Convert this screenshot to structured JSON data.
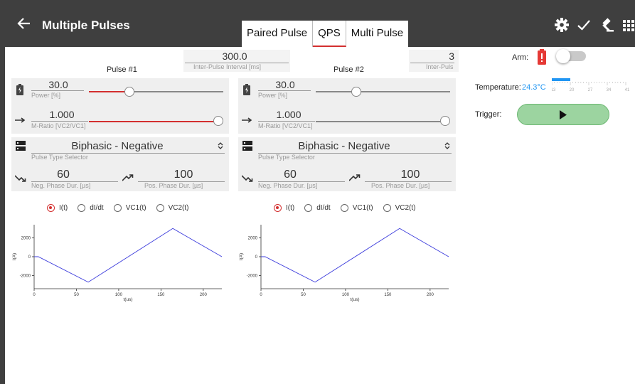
{
  "header": {
    "title": "Multiple Pulses",
    "back_icon": "arrow-left-icon",
    "tabs": [
      {
        "label": "Paired Pulse"
      },
      {
        "label": "QPS"
      },
      {
        "label": "Multi Pulse"
      }
    ],
    "actions": [
      "gear-icon",
      "check-icon",
      "gavel-icon",
      "grid-icon"
    ]
  },
  "pulses": [
    {
      "title": "Pulse #1",
      "power": {
        "value": "30.0",
        "label": "Power [%]",
        "level": 0.3
      },
      "mratio": {
        "value": "1.000",
        "label": "M-Ratio [VC2/VC1]",
        "level": 1.0
      },
      "pulse_type": {
        "value": "Biphasic - Negative",
        "label": "Pulse Type Selector"
      },
      "neg_phase": {
        "value": "60",
        "label": "Neg. Phase Dur. [µs]"
      },
      "pos_phase": {
        "value": "100",
        "label": "Pos. Phase Dur. [µs]"
      },
      "radios": [
        "I(t)",
        "dI/dt",
        "VC1(t)",
        "VC2(t)"
      ]
    },
    {
      "title": "Pulse #2",
      "power": {
        "value": "30.0",
        "label": "Power [%]",
        "level": 0.3
      },
      "mratio": {
        "value": "1.000",
        "label": "M-Ratio [VC2/VC1]",
        "level": 1.0
      },
      "pulse_type": {
        "value": "Biphasic - Negative",
        "label": "Pulse Type Selector"
      },
      "neg_phase": {
        "value": "60",
        "label": "Neg. Phase Dur. [µs]"
      },
      "pos_phase": {
        "value": "100",
        "label": "Pos. Phase Dur. [µs]"
      },
      "radios": [
        "I(t)",
        "dI/dt",
        "VC1(t)",
        "VC2(t)"
      ]
    }
  ],
  "ipi": [
    {
      "value": "300.0",
      "label": "Inter-Pulse Interval [ms]"
    },
    {
      "value": "3",
      "label": "Inter-Puls"
    }
  ],
  "side": {
    "arm_label": "Arm:",
    "temp_label": "Temperature:",
    "temp_value": "24.3°C",
    "temp_ticks": [
      "13",
      "20",
      "27",
      "34",
      "41"
    ],
    "temp_level": 0.25,
    "trigger_label": "Trigger:"
  },
  "chart_data": [
    {
      "type": "line",
      "xlabel": "t(us)",
      "ylabel": "I(A)",
      "x": [
        0,
        5,
        64,
        164,
        222
      ],
      "y": [
        0,
        0,
        -2700,
        3000,
        0
      ],
      "xlim": [
        0,
        222
      ],
      "ylim": [
        -3400,
        3400
      ],
      "xticks": [
        0,
        50,
        100,
        150,
        200
      ],
      "yticks": [
        2000,
        0,
        -2000
      ],
      "ytick_labels": [
        "2000",
        "0",
        "-2000"
      ],
      "color": "#3b3bdc"
    },
    {
      "type": "line",
      "xlabel": "t(us)",
      "ylabel": "I(A)",
      "x": [
        0,
        5,
        64,
        164,
        222
      ],
      "y": [
        0,
        0,
        -2700,
        3000,
        0
      ],
      "xlim": [
        0,
        222
      ],
      "ylim": [
        -3400,
        3400
      ],
      "xticks": [
        0,
        50,
        100,
        150,
        200
      ],
      "yticks": [
        2000,
        0,
        -2000
      ],
      "ytick_labels": [
        "2000",
        "0",
        "-2000"
      ],
      "color": "#3b3bdc"
    }
  ]
}
